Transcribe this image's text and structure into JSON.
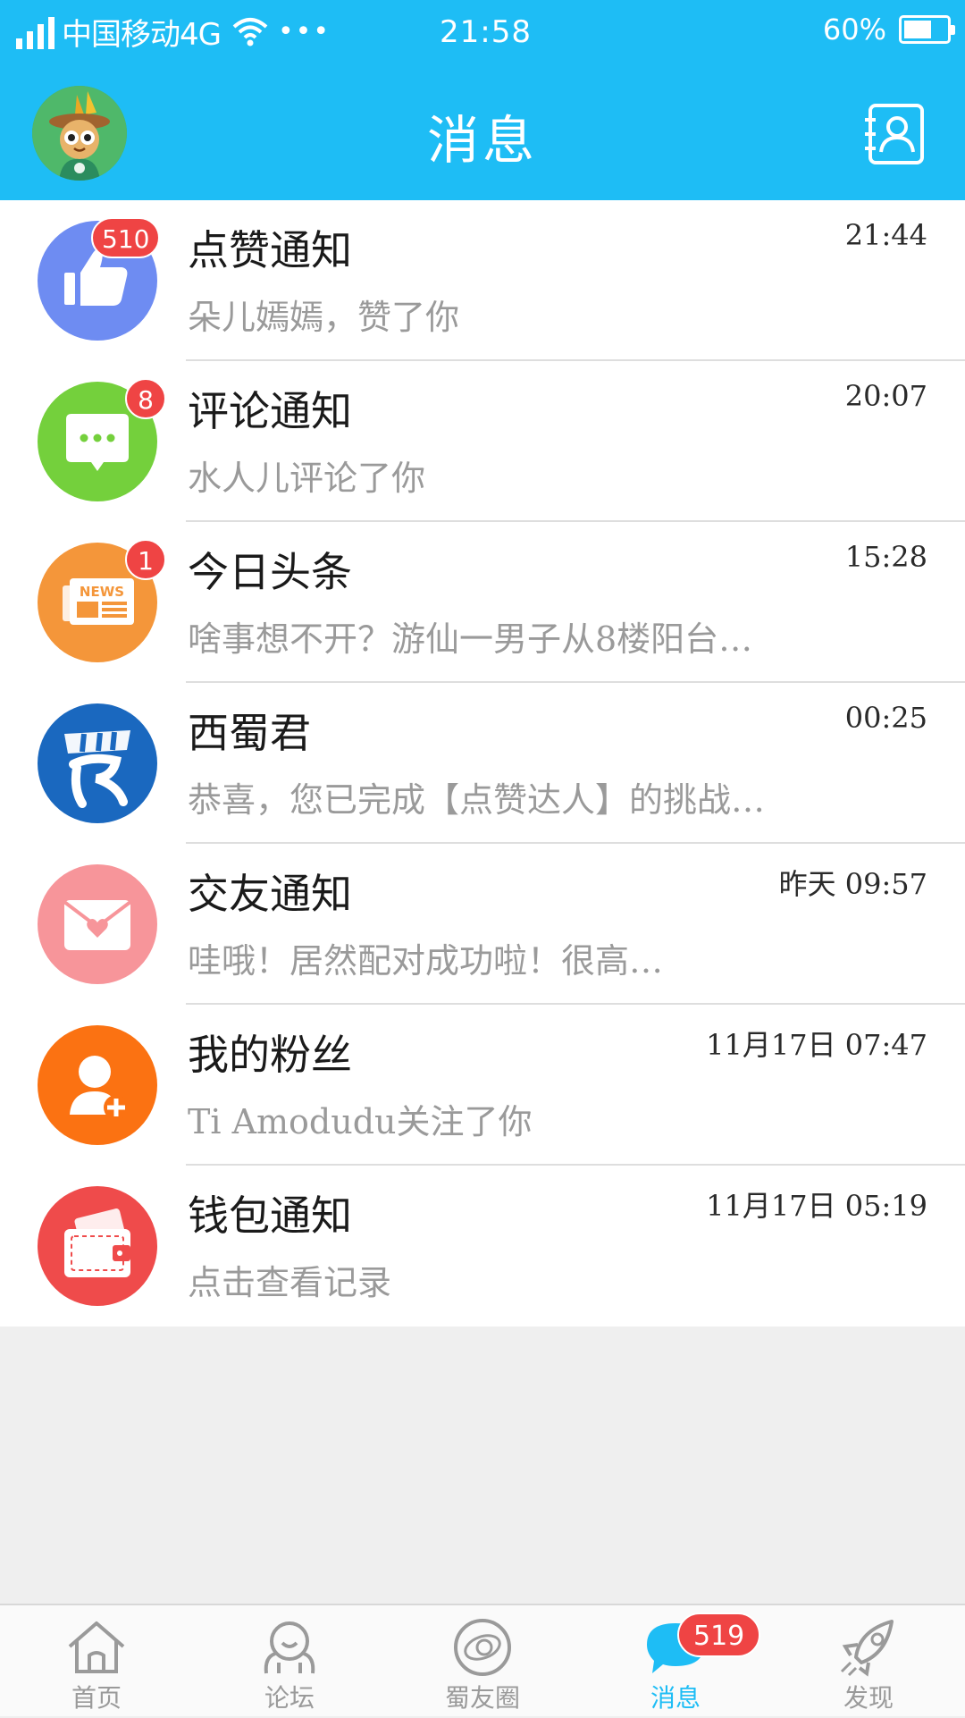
{
  "status_bar": {
    "carrier": "中国移动4G",
    "dots": "•••",
    "time": "21:58",
    "battery_percent": "60%",
    "battery_level": 0.6
  },
  "header": {
    "title": "消息",
    "background_color": "#1ebdf5"
  },
  "messages": [
    {
      "title": "点赞通知",
      "time": "21:44",
      "subtitle": "朵儿嫣嫣，赞了你",
      "badge": "510",
      "icon": "thumbs-up-icon",
      "color": "#6e8cf2"
    },
    {
      "title": "评论通知",
      "time": "20:07",
      "subtitle": "水人儿评论了你",
      "badge": "8",
      "icon": "comment-bubble-icon",
      "color": "#74d03c"
    },
    {
      "title": "今日头条",
      "time": "15:28",
      "subtitle": "啥事想不开？游仙一男子从8楼阳台…",
      "badge": "1",
      "icon": "newspaper-icon",
      "color": "#f4963a"
    },
    {
      "title": "西蜀君",
      "time": "00:25",
      "subtitle": "恭喜，您已完成【点赞达人】的挑战…",
      "badge": "",
      "icon": "shu-logo-icon",
      "color": "#1a68bf"
    },
    {
      "title": "交友通知",
      "time": "昨天 09:57",
      "subtitle": "哇哦！居然配对成功啦！很高…",
      "badge": "",
      "icon": "heart-envelope-icon",
      "color": "#f7959a"
    },
    {
      "title": "我的粉丝",
      "time": "11月17日 07:47",
      "subtitle": "Ti Amodudu关注了你",
      "badge": "",
      "icon": "add-user-icon",
      "color": "#fb7212"
    },
    {
      "title": "钱包通知",
      "time": "11月17日 05:19",
      "subtitle": "点击查看记录",
      "badge": "",
      "icon": "wallet-icon",
      "color": "#ef4b4b"
    }
  ],
  "tabbar": {
    "items": [
      {
        "label": "首页",
        "icon": "home-icon",
        "active": false
      },
      {
        "label": "论坛",
        "icon": "forum-icon",
        "active": false
      },
      {
        "label": "蜀友圈",
        "icon": "circle-icon",
        "active": false
      },
      {
        "label": "消息",
        "icon": "message-icon",
        "active": true,
        "badge": "519"
      },
      {
        "label": "发现",
        "icon": "rocket-icon",
        "active": false
      }
    ],
    "active_color": "#1ebdf5"
  }
}
